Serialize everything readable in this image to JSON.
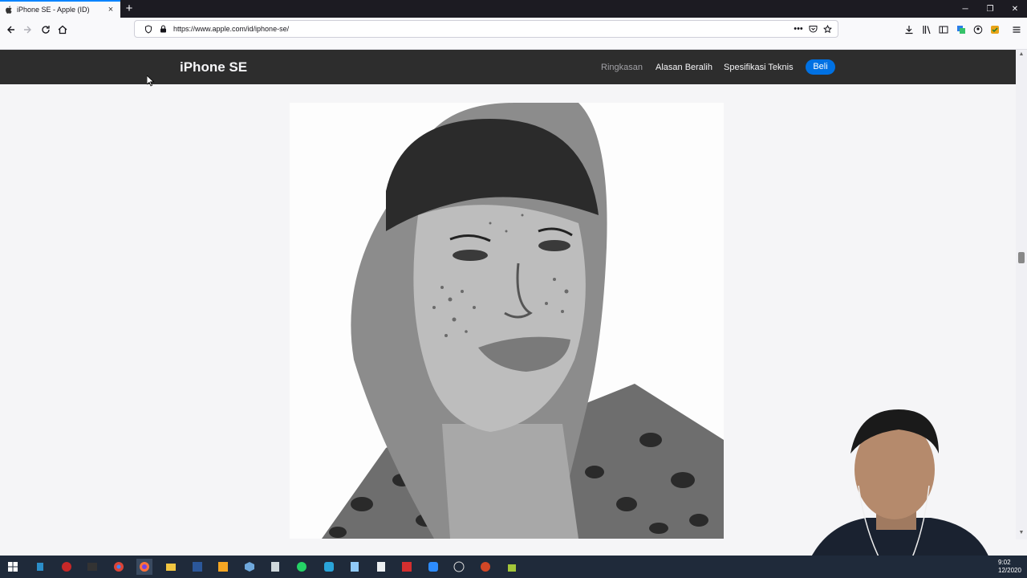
{
  "browser": {
    "tab_title": "iPhone SE - Apple (ID)",
    "url": "https://www.apple.com/id/iphone-se/",
    "accent": "#0a84ff"
  },
  "localnav": {
    "title": "iPhone SE",
    "links": [
      "Ringkasan",
      "Alasan Beralih",
      "Spesifikasi Teknis"
    ],
    "buy_label": "Beli",
    "buy_color": "#0071e3"
  },
  "hero": {
    "image": "black-and-white portrait of a freckled man in a hood and leopard-print jacket"
  },
  "taskbar": {
    "time": "9:02",
    "date": "12/2020"
  },
  "icons": {
    "back": "back-arrow-icon",
    "forward": "forward-arrow-icon",
    "reload": "reload-icon",
    "home": "home-icon",
    "shield": "shield-icon",
    "lock": "lock-icon",
    "more": "more-dots-icon",
    "pocket": "pocket-icon",
    "bookmark": "star-icon"
  }
}
